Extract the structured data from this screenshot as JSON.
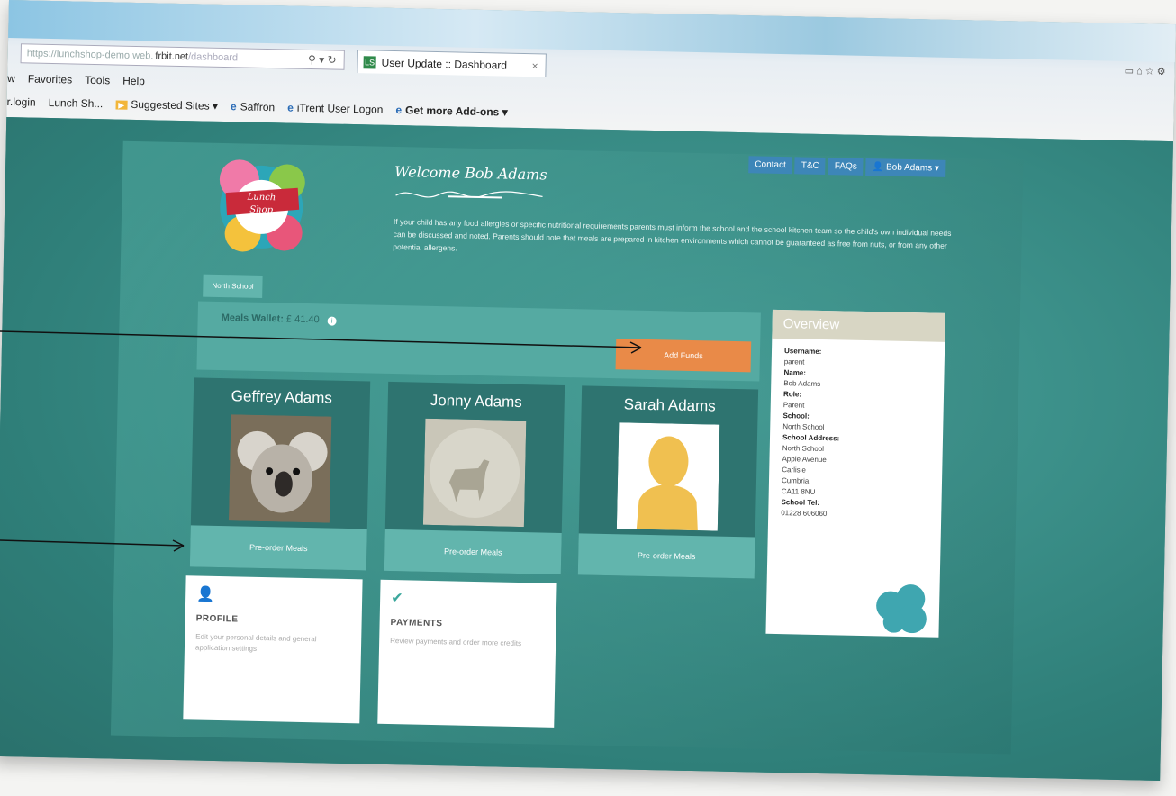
{
  "browser": {
    "address": {
      "prefix": "https://lunchshop-demo.web.",
      "domain": "frbit.net",
      "path": "/dashboard"
    },
    "tab_title": "User Update :: Dashboard",
    "menu": [
      "w",
      "Favorites",
      "Tools",
      "Help"
    ],
    "favorites": [
      {
        "label": "r.login",
        "icon": ""
      },
      {
        "label": "Lunch Sh...",
        "icon": ""
      },
      {
        "label": "Suggested Sites ▾",
        "icon": "suggested-sites-icon"
      },
      {
        "label": "Saffron",
        "icon": "ie-icon"
      },
      {
        "label": "iTrent User Logon",
        "icon": "ie-icon"
      },
      {
        "label": "Get more Add-ons ▾",
        "icon": "ie-icon"
      }
    ]
  },
  "topnav": [
    "Contact",
    "T&C",
    "FAQs",
    "👤 Bob Adams ▾"
  ],
  "header": {
    "welcome": "Welcome Bob Adams",
    "intro": "If your child has any food allergies or specific nutritional requirements parents must inform the school and the school kitchen team so the child's own individual needs can be discussed and noted. Parents should note that meals are prepared in kitchen environments which cannot be guaranteed as free from nuts, or from any other potential allergens."
  },
  "school_tab": "North School",
  "wallet": {
    "label": "Meals Wallet:",
    "amount": "£ 41.40",
    "add_funds": "Add Funds"
  },
  "children": [
    {
      "name": "Geffrey Adams",
      "button": "Pre-order Meals",
      "photo": "koala"
    },
    {
      "name": "Jonny Adams",
      "button": "Pre-order Meals",
      "photo": "deer"
    },
    {
      "name": "Sarah Adams",
      "button": "Pre-order Meals",
      "photo": "silhouette"
    }
  ],
  "cards": [
    {
      "title": "PROFILE",
      "desc": "Edit your personal details and general application settings",
      "icon": "user-icon"
    },
    {
      "title": "PAYMENTS",
      "desc": "Review payments and order more credits",
      "icon": "check-icon"
    }
  ],
  "overview": {
    "title": "Overview",
    "fields": [
      {
        "label": "Username:",
        "value": "parent"
      },
      {
        "label": "Name:",
        "value": "Bob Adams"
      },
      {
        "label": "Role:",
        "value": "Parent"
      },
      {
        "label": "School:",
        "value": "North School"
      },
      {
        "label": "School Address:",
        "value": "North School\nApple Avenue\nCarlisle\nCumbria\nCA11 8NU"
      },
      {
        "label": "School Tel:",
        "value": "01228 606060"
      }
    ]
  },
  "colors": {
    "teal": "#3c8e88",
    "accent_orange": "#e98a48",
    "tile": "#62b5ad",
    "nav_blue": "#3d86b8"
  }
}
